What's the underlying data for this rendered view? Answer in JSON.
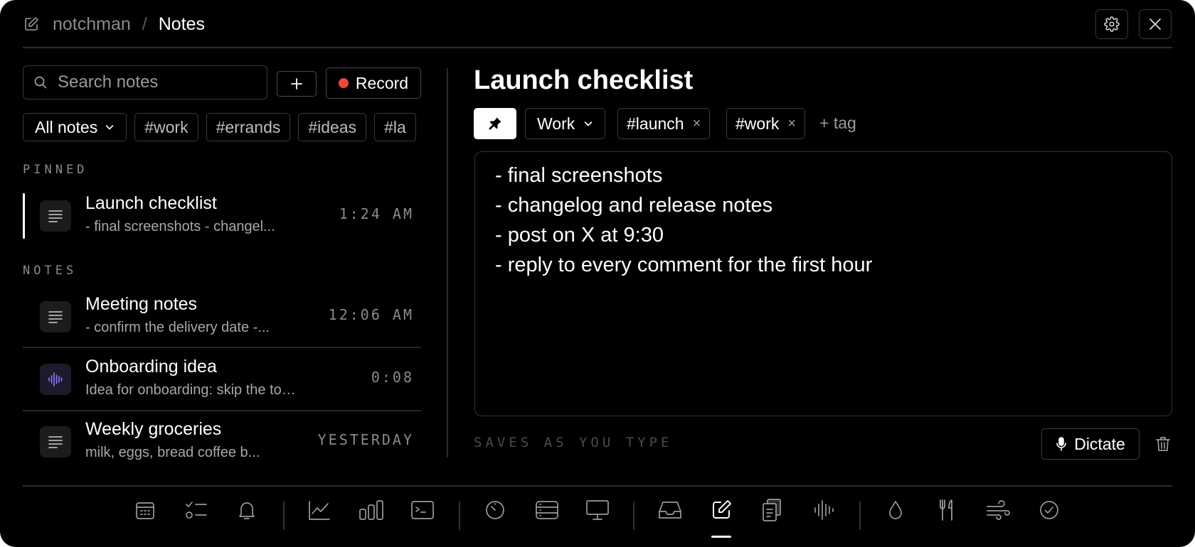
{
  "header": {
    "app_name": "notchman",
    "separator": "/",
    "page_title": "Notes",
    "app_icon": "edit-icon",
    "settings_icon": "gear-icon",
    "close_icon": "close-icon"
  },
  "sidebar": {
    "search": {
      "placeholder": "Search notes",
      "value": "",
      "icon": "search-icon"
    },
    "add_label": "+",
    "record_label": "Record",
    "record_color": "#f0443a",
    "filters": [
      "All notes",
      "#work",
      "#errands",
      "#ideas",
      "#la"
    ],
    "pinned_label": "PINNED",
    "notes_label": "NOTES",
    "pinned": [
      {
        "title": "Launch checklist",
        "preview": "- final screenshots - changel...",
        "time": "1:24 AM",
        "icon": "text-lines-icon",
        "active": true
      }
    ],
    "notes": [
      {
        "title": "Meeting notes",
        "preview": "- confirm the delivery date -...",
        "time": "12:06 AM",
        "icon": "text-lines-icon"
      },
      {
        "title": "Onboarding idea",
        "preview": "Idea for onboarding: skip the tour....",
        "time": "0:08",
        "icon": "waveform-icon"
      },
      {
        "title": "Weekly groceries",
        "preview": "milk, eggs, bread coffee b...",
        "time": "YESTERDAY",
        "icon": "text-lines-icon"
      }
    ]
  },
  "editor": {
    "title": "Launch checklist",
    "pin_icon": "pin-icon",
    "folder": "Work",
    "tags": [
      {
        "label": "#launch",
        "remove": "×"
      },
      {
        "label": "#work",
        "remove": "×"
      }
    ],
    "add_tag_label": "+ tag",
    "lines": [
      "- final screenshots",
      "- changelog and release notes",
      "- post on X at 9:30",
      "- reply to every comment for the first hour"
    ],
    "save_status": "SAVES AS YOU TYPE",
    "dictate_label": "Dictate",
    "dictate_icon": "microphone-icon",
    "delete_icon": "trash-icon"
  },
  "dock": {
    "items": [
      "calendar-icon",
      "checklist-icon",
      "bell-icon",
      "line-chart-icon",
      "bar-chart-icon",
      "terminal-icon",
      "timer-icon",
      "server-icon",
      "monitor-icon",
      "inbox-icon",
      "notes-icon",
      "clipboard-icon",
      "waveform-icon",
      "water-drop-icon",
      "fork-knife-icon",
      "wind-icon",
      "check-circle-icon"
    ],
    "active": "notes-icon"
  },
  "colors": {
    "background": "#000000",
    "text": "#ffffff",
    "muted": "#8a8a8a",
    "border": "#3a3a3a",
    "record_dot": "#f0443a",
    "voice_icon": "#8a7cff"
  }
}
